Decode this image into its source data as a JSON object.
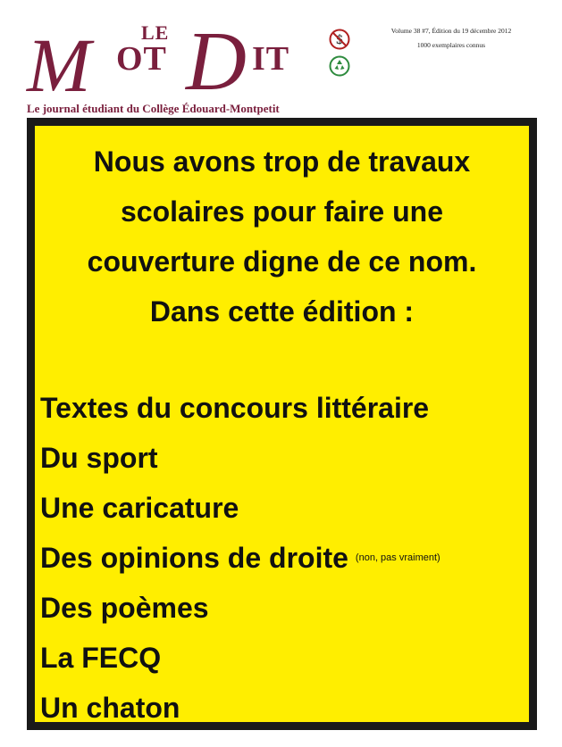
{
  "masthead": {
    "logo": {
      "le": "LE",
      "m": "M",
      "ot": "OT",
      "d": "D",
      "it": "IT"
    },
    "tagline": "Le journal étudiant du Collège Édouard-Montpetit",
    "edition_line": "Volume 38 #7, Édition du 19 décembre 2012",
    "copies_line": "1000 exemplaires connus",
    "brand_color": "#7a1f3d",
    "badges": [
      "dollar-circle-icon",
      "recycle-icon"
    ]
  },
  "cover": {
    "background_color": "#ffee00",
    "intro_lines": [
      "Nous avons trop de travaux",
      "scolaires pour faire une",
      "couverture digne de ce nom.",
      "Dans cette édition :"
    ],
    "items": [
      {
        "text": "Textes du concours littéraire",
        "note": ""
      },
      {
        "text": "Du sport",
        "note": ""
      },
      {
        "text": "Une caricature",
        "note": ""
      },
      {
        "text": "Des opinions de droite",
        "note": "(non, pas vraiment)"
      },
      {
        "text": "Des poèmes",
        "note": ""
      },
      {
        "text": "La FECQ",
        "note": ""
      },
      {
        "text": "Un chaton",
        "note": ""
      }
    ]
  }
}
